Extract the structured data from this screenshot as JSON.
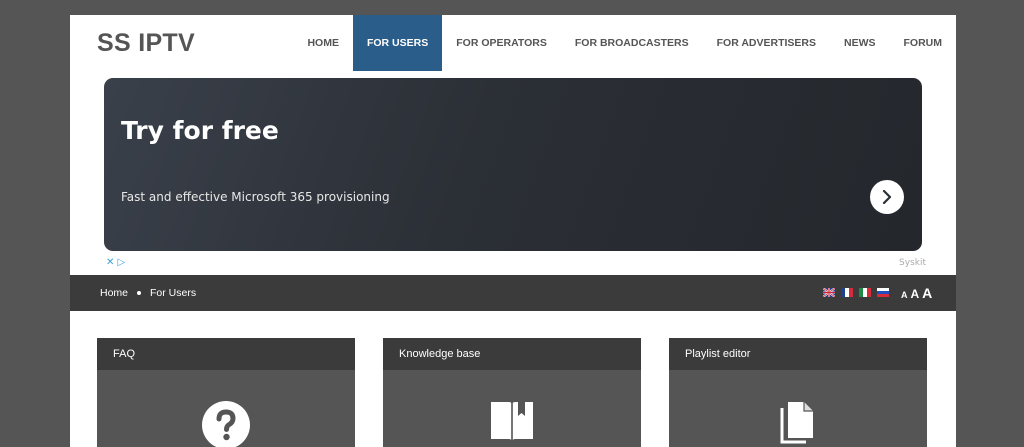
{
  "logo": "SS IPTV",
  "nav": [
    {
      "label": "HOME",
      "active": false
    },
    {
      "label": "FOR USERS",
      "active": true
    },
    {
      "label": "FOR OPERATORS",
      "active": false
    },
    {
      "label": "FOR BROADCASTERS",
      "active": false
    },
    {
      "label": "FOR ADVERTISERS",
      "active": false
    },
    {
      "label": "NEWS",
      "active": false
    },
    {
      "label": "FORUM",
      "active": false
    }
  ],
  "ad": {
    "title": "Try for free",
    "subtitle": "Fast and effective Microsoft 365 provisioning",
    "brand": "Syskit",
    "marks": "✕ ▷"
  },
  "breadcrumb": [
    "Home",
    "For Users"
  ],
  "languages": [
    "English",
    "French",
    "Italian",
    "Russian"
  ],
  "font_sizes": [
    "A",
    "A",
    "A"
  ],
  "cards": [
    {
      "title": "FAQ",
      "icon": "question-icon"
    },
    {
      "title": "Knowledge base",
      "icon": "book-icon"
    },
    {
      "title": "Playlist editor",
      "icon": "document-icon"
    }
  ],
  "colors": {
    "background": "#555555",
    "nav_active": "#2a5d8a",
    "dark_bar": "#3b3b3b",
    "card_body": "#555555"
  }
}
